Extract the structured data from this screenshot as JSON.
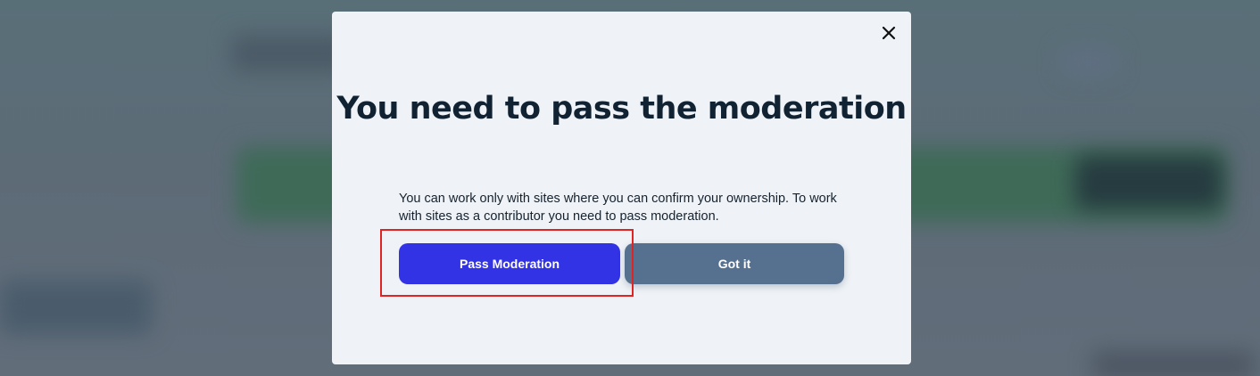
{
  "modal": {
    "title": "You need to pass the moderation",
    "message": "You can work only with sites where you can confirm your ownership. To work with sites as a contributor you need to pass moderation.",
    "close_icon": "close-icon",
    "primary_button_label": "Pass Moderation",
    "secondary_button_label": "Got it"
  },
  "colors": {
    "primary_button": "#3333e6",
    "secondary_button": "#56708f",
    "modal_background": "#eff3f7",
    "title_text": "#112233",
    "highlight_border": "#e02424"
  }
}
